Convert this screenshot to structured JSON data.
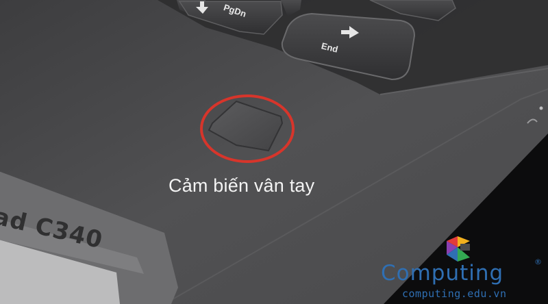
{
  "caption": "Cảm biến vân tay",
  "keys": {
    "pgdn": "PgDn",
    "end": "End"
  },
  "sticker": {
    "text": "ad C340"
  },
  "watermark": {
    "brand": "Computing",
    "registered": "®",
    "url": "computing.edu.vn",
    "logo_colors": [
      "#e23b3b",
      "#f2b01e",
      "#33a852",
      "#2f6fb3",
      "#8a3fb0"
    ]
  },
  "colors": {
    "highlight_ring": "#d7352b",
    "surface": "#4a4a4c",
    "brand": "#2f6fb3"
  },
  "icons": [
    "arrow-down-icon",
    "arrow-right-icon",
    "fingerprint-sensor-icon",
    "computing-logo-icon"
  ]
}
